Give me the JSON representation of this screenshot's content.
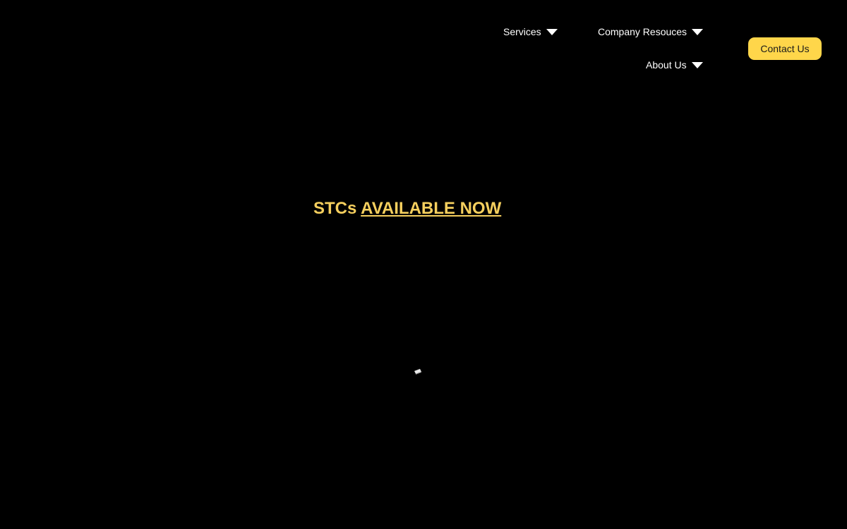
{
  "nav": {
    "services": {
      "label": "Services",
      "icon": "caret-down-icon"
    },
    "company_resources": {
      "label": "Company Resouces",
      "icon": "caret-down-icon"
    },
    "about_us": {
      "label": "About Us",
      "icon": "caret-down-icon"
    }
  },
  "header": {
    "contact_label": "Contact Us"
  },
  "hero": {
    "prefix": "STCs",
    "link_text": "AVAILABLE NOW"
  },
  "loading": {
    "icon": "loading-spinner-icon"
  },
  "colors": {
    "background": "#000000",
    "accent": "#ffd64a",
    "headline": "#f5cf5e",
    "nav_text": "#ffffff"
  }
}
